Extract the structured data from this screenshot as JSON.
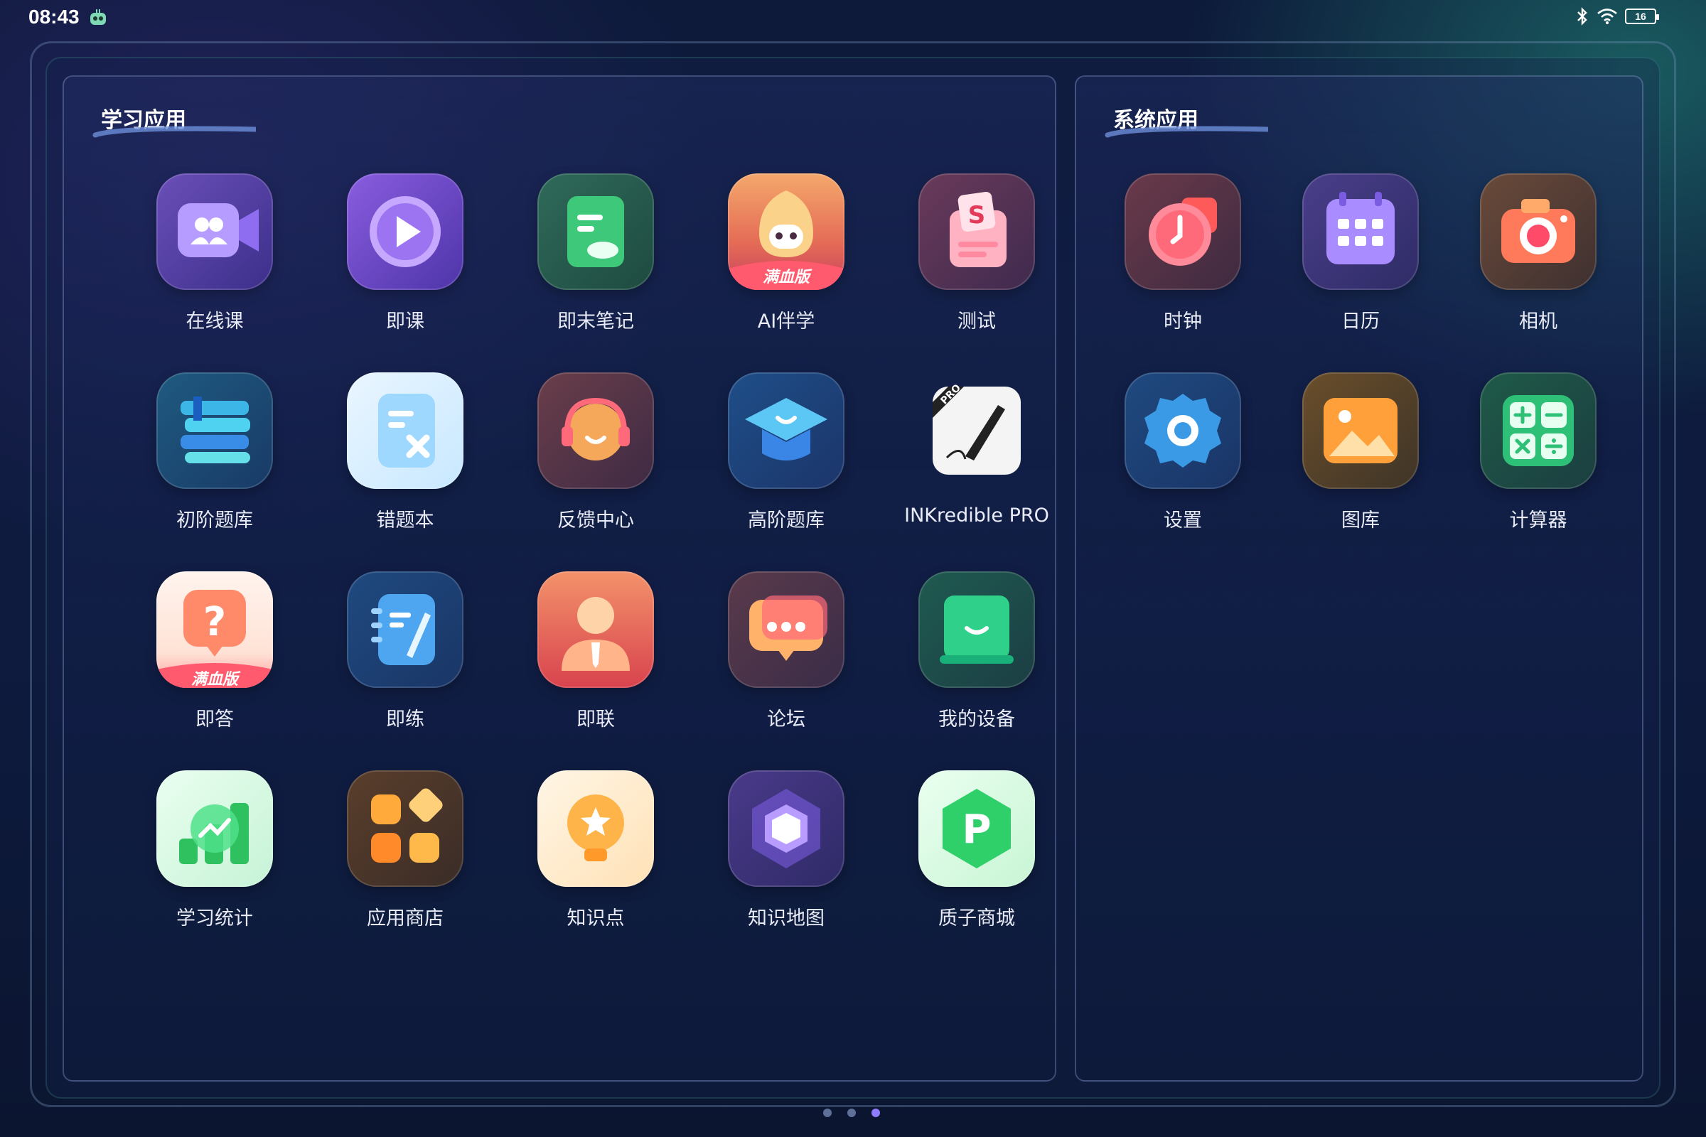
{
  "status_bar": {
    "time": "08:43",
    "battery": "16",
    "icons": [
      "robot-icon",
      "bluetooth-icon",
      "wifi-icon",
      "battery-icon"
    ]
  },
  "learning_apps": {
    "title": "学习应用",
    "apps": [
      {
        "label": "在线课",
        "icon": "video-class-icon"
      },
      {
        "label": "即课",
        "icon": "play-icon"
      },
      {
        "label": "即末笔记",
        "icon": "note-icon"
      },
      {
        "label": "AI伴学",
        "icon": "ai-mascot-icon",
        "badge": "满血版"
      },
      {
        "label": "测试",
        "icon": "test-icon"
      },
      {
        "label": "初阶题库",
        "icon": "books-icon"
      },
      {
        "label": "错题本",
        "icon": "wrong-question-icon"
      },
      {
        "label": "反馈中心",
        "icon": "headset-icon"
      },
      {
        "label": "高阶题库",
        "icon": "graduation-cap-icon"
      },
      {
        "label": "INKredible PRO",
        "icon": "pen-icon",
        "badge": "PRO"
      },
      {
        "label": "即答",
        "icon": "question-icon",
        "badge": "满血版"
      },
      {
        "label": "即练",
        "icon": "notebook-pen-icon"
      },
      {
        "label": "即联",
        "icon": "person-icon"
      },
      {
        "label": "论坛",
        "icon": "chat-bubble-icon"
      },
      {
        "label": "我的设备",
        "icon": "device-icon"
      },
      {
        "label": "学习统计",
        "icon": "stats-icon"
      },
      {
        "label": "应用商店",
        "icon": "app-store-icon"
      },
      {
        "label": "知识点",
        "icon": "bulb-star-icon"
      },
      {
        "label": "知识地图",
        "icon": "hexagon-icon"
      },
      {
        "label": "质子商城",
        "icon": "proton-store-icon",
        "badge": "P"
      }
    ]
  },
  "system_apps": {
    "title": "系统应用",
    "apps": [
      {
        "label": "时钟",
        "icon": "clock-icon"
      },
      {
        "label": "日历",
        "icon": "calendar-icon"
      },
      {
        "label": "相机",
        "icon": "camera-icon"
      },
      {
        "label": "设置",
        "icon": "gear-icon"
      },
      {
        "label": "图库",
        "icon": "gallery-icon"
      },
      {
        "label": "计算器",
        "icon": "calculator-icon"
      }
    ]
  },
  "pagination": {
    "pages": 3,
    "active": 3
  }
}
